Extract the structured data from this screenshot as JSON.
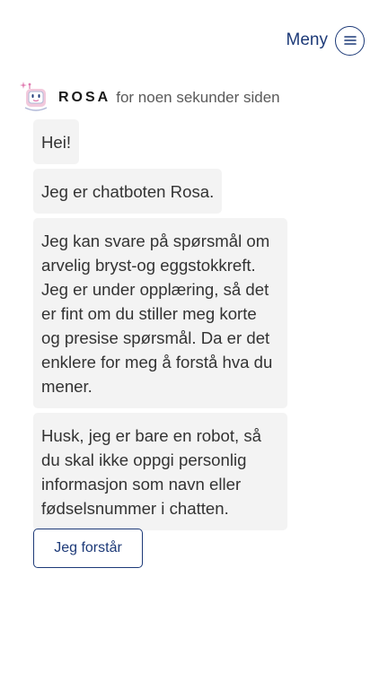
{
  "header": {
    "menu_label": "Meny",
    "menu_icon": "hamburger-icon"
  },
  "bot": {
    "name": "ROSA",
    "timestamp": "for noen sekunder siden",
    "avatar_icon": "robot-icon"
  },
  "messages": [
    {
      "text": "Hei!"
    },
    {
      "text": "Jeg er chatboten Rosa."
    },
    {
      "text": "Jeg kan svare på spørsmål om arvelig bryst-og eggstokkreft. Jeg er under opplæring, så det er fint om du stiller meg korte og presise spørsmål. Da er det enklere for meg å forstå hva du mener."
    },
    {
      "text": "Husk, jeg er bare en robot, så du skal ikke oppgi personlig informasjon som navn eller fødselsnummer i chatten."
    }
  ],
  "actions": {
    "acknowledge_label": "Jeg forstår"
  },
  "colors": {
    "accent": "#1d3a78",
    "bubble": "#f3f3f3",
    "text": "#333333",
    "avatar_accent": "#e07ab0"
  }
}
